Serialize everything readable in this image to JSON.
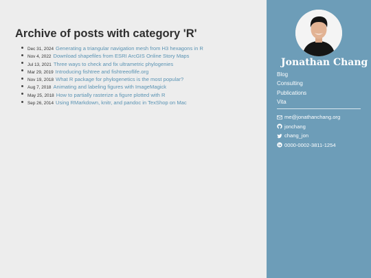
{
  "main": {
    "title": "Archive of posts with category 'R'",
    "posts": [
      {
        "date": "Dec 31, 2024",
        "title": "Generating a triangular navigation mesh from H3 hexagons in R"
      },
      {
        "date": "Nov 4, 2022",
        "title": "Download shapefiles from ESRI ArcGIS Online Story Maps"
      },
      {
        "date": "Jul 13, 2021",
        "title": "Three ways to check and fix ultrametric phylogenies"
      },
      {
        "date": "Mar 29, 2019",
        "title": "Introducing fishtree and fishtreeoflife.org"
      },
      {
        "date": "Nov 19, 2018",
        "title": "What R package for phylogenetics is the most popular?"
      },
      {
        "date": "Aug 7, 2018",
        "title": "Animating and labeling figures with ImageMagick"
      },
      {
        "date": "May 25, 2018",
        "title": "How to partially rasterize a figure plotted with R"
      },
      {
        "date": "Sep 26, 2014",
        "title": "Using RMarkdown, knitr, and pandoc in TexShop on Mac"
      }
    ]
  },
  "sidebar": {
    "site_title": "Jonathan Chang",
    "nav": [
      "Blog",
      "Consulting",
      "Publications",
      "Vita"
    ],
    "contacts": {
      "email": "me@jonathanchang.org",
      "github": "jonchang",
      "twitter": "chang_jon",
      "orcid": "0000-0002-3811-1254"
    }
  },
  "colors": {
    "sidebar_bg": "#6d9db8",
    "link": "#5a93b3",
    "page_bg": "#ededed"
  },
  "icons": [
    "envelope-icon",
    "github-icon",
    "twitter-icon",
    "orcid-icon"
  ]
}
